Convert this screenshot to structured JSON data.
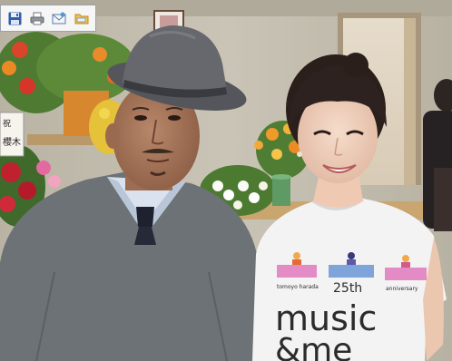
{
  "toolbar": {
    "buttons": [
      {
        "name": "save",
        "icon": "floppy-disk-icon"
      },
      {
        "name": "print",
        "icon": "printer-icon"
      },
      {
        "name": "email",
        "icon": "email-icon"
      },
      {
        "name": "folder",
        "icon": "folder-icon"
      }
    ]
  },
  "photo": {
    "tshirt_small_text_left": "tomoyo harada",
    "tshirt_25th": "25th",
    "tshirt_small_text_right": "anniversary",
    "tshirt_line1": "music",
    "tshirt_line2": "&me",
    "sign_prefix": "祝",
    "sign_text": "櫻木"
  },
  "colors": {
    "wall": "#c4bfb1",
    "sweater": "#6f7478",
    "tshirt": "#f2f2f2",
    "hat": "#5e5e62"
  }
}
